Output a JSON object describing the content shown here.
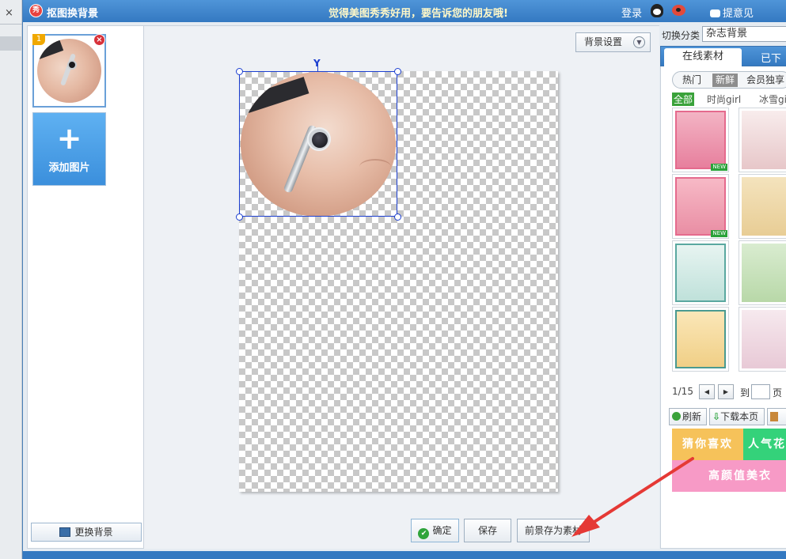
{
  "outer": {
    "close_glyph": "×"
  },
  "window": {
    "logo": "秀",
    "title": "抠图换背景",
    "slogan": "觉得美图秀秀好用，要告诉您的朋友哦!",
    "login": "登录",
    "feedback": "提意见",
    "icons": [
      "qq-icon",
      "weibo-icon",
      "feedback-bubble-icon"
    ]
  },
  "left_panel": {
    "thumb_index": "1",
    "delete_glyph": "×",
    "add_plus": "+",
    "add_label": "添加图片",
    "change_bg": "更换背景"
  },
  "canvas": {
    "bg_settings": "背景设置",
    "chevron": "▼",
    "rotate_handle": "Y",
    "ok": "确定",
    "ok_glyph": "✔",
    "save": "保存",
    "save_fg": "前景存为素材"
  },
  "right_panel": {
    "category_label": "切换分类",
    "category_value": "杂志背景",
    "tab_online": "在线素材",
    "tab_downloaded": "已下载",
    "subtabs": [
      "热门",
      "新鲜",
      "会员独享"
    ],
    "active_subtab": "新鲜",
    "filters": [
      "全部",
      "时尚girl",
      "冰雪girl"
    ],
    "new_tag": "NEW",
    "pager": {
      "page": "1/15",
      "prev": "◀",
      "next": "▶",
      "to": "到",
      "page_unit": "页"
    },
    "actions": {
      "refresh": "刷新",
      "download_page": "下载本页",
      "download_glyph": "⇩"
    },
    "ads": [
      "猜你喜欢",
      "人气花",
      "高颜值美衣"
    ]
  },
  "colors": {
    "title_bar": "#3479c1",
    "selection": "#1c3fd0",
    "arrow": "#e53935",
    "ok_check": "#2fa43b"
  }
}
